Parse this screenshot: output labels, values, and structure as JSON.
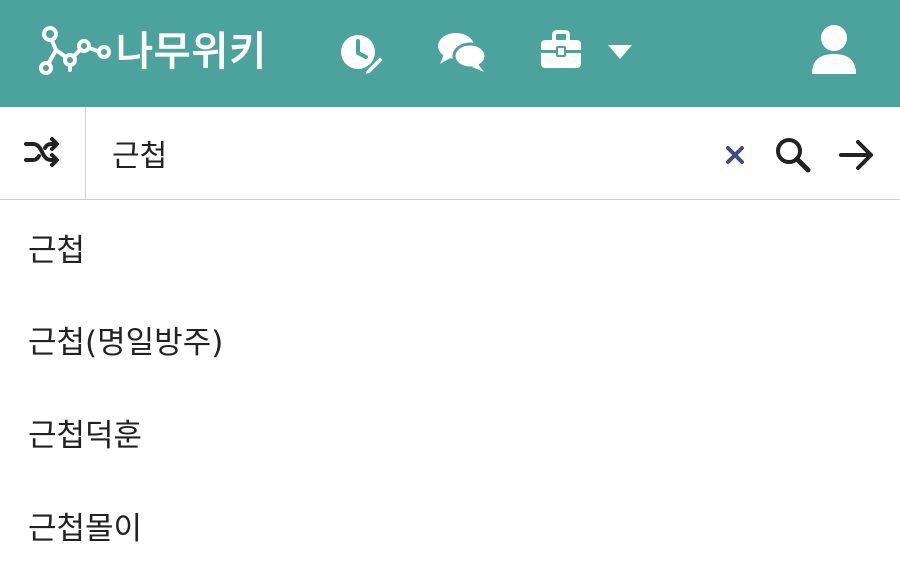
{
  "header": {
    "logo_text": "나무위키",
    "icons": {
      "logo": "tree-logo-icon",
      "recent": "recent-changes-icon",
      "discuss": "discussion-icon",
      "tools": "toolbox-icon",
      "dropdown": "caret-down-icon",
      "user": "user-icon"
    }
  },
  "search": {
    "value": "근첩",
    "random_icon": "shuffle-icon",
    "clear_icon": "close-icon",
    "search_icon": "search-icon",
    "go_icon": "arrow-right-icon"
  },
  "suggestions": [
    {
      "label": "근첩"
    },
    {
      "label": "근첩(명일방주)"
    },
    {
      "label": "근첩덕훈"
    },
    {
      "label": "근첩몰이"
    }
  ],
  "colors": {
    "header_bg": "#4ca29d",
    "clear_icon": "#3f4f7a",
    "text": "#222222"
  }
}
